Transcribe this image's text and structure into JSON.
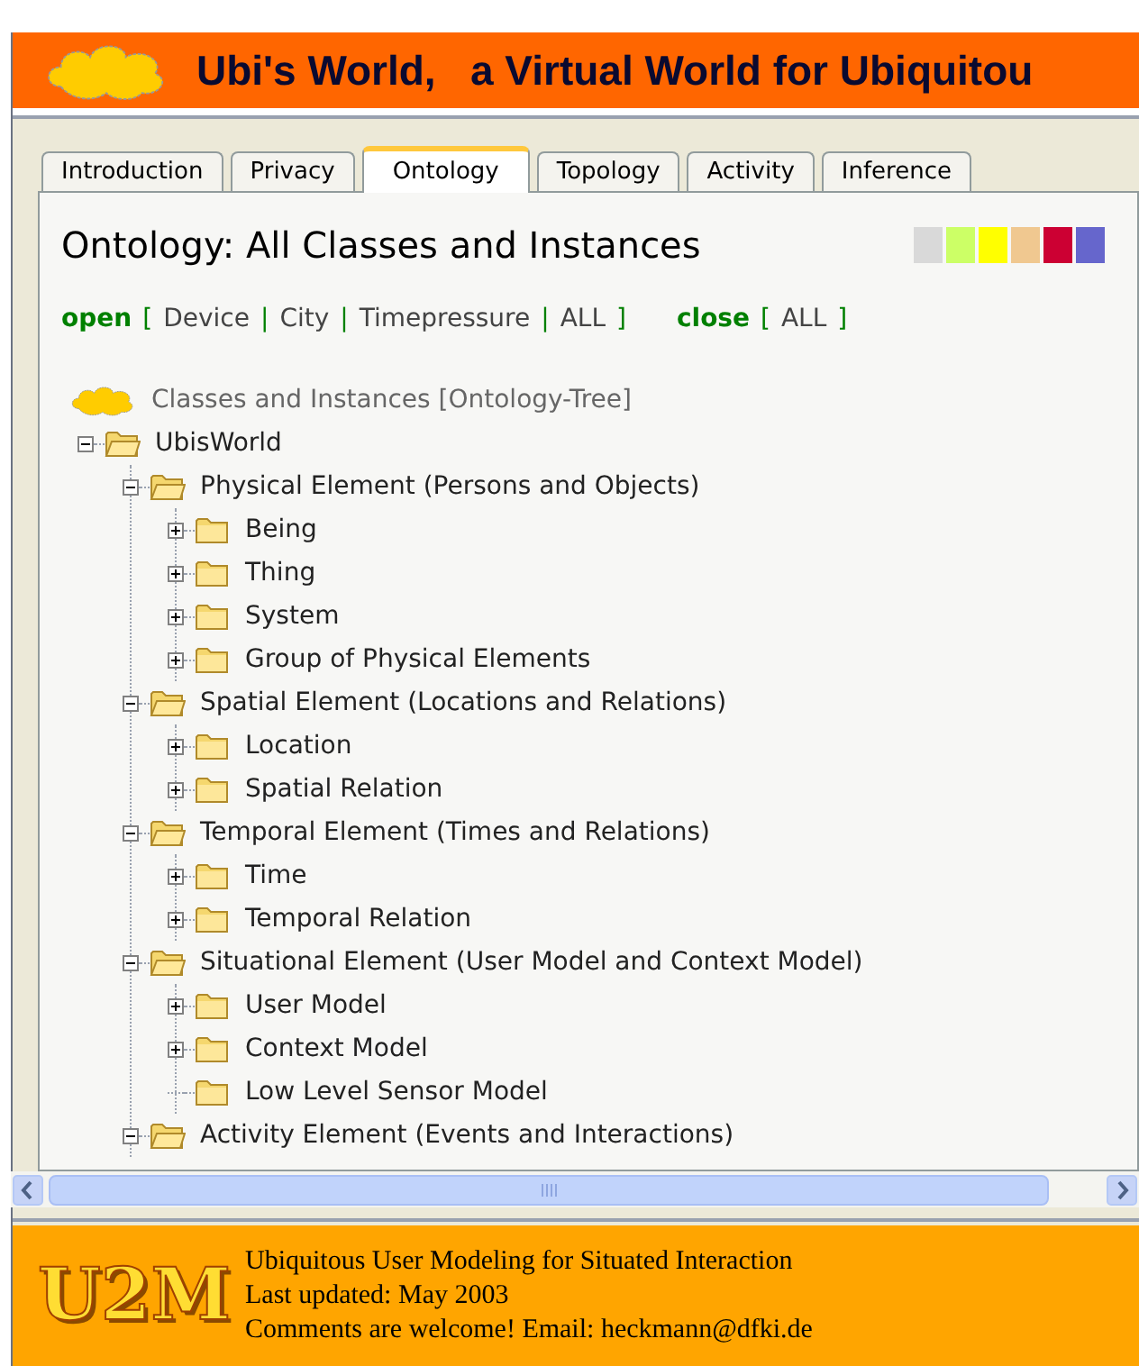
{
  "header": {
    "title": "Ubi's World,   a Virtual World for Ubiquitou"
  },
  "tabs": [
    {
      "label": "Introduction",
      "selected": false
    },
    {
      "label": "Privacy",
      "selected": false
    },
    {
      "label": "Ontology",
      "selected": true
    },
    {
      "label": "Topology",
      "selected": false
    },
    {
      "label": "Activity",
      "selected": false
    },
    {
      "label": "Inference",
      "selected": false
    }
  ],
  "panel": {
    "title": "Ontology: All Classes and Instances",
    "swatches": [
      {
        "color": "#d9d9d9"
      },
      {
        "color": "#ccff66"
      },
      {
        "color": "#ffff00"
      },
      {
        "color": "#f0c890"
      },
      {
        "color": "#cc0033"
      },
      {
        "color": "#6666cc"
      }
    ],
    "actions": [
      {
        "kind": "label",
        "text": "open"
      },
      {
        "kind": "punct",
        "text": "["
      },
      {
        "kind": "link",
        "text": "Device"
      },
      {
        "kind": "punct",
        "text": "|"
      },
      {
        "kind": "link",
        "text": "City"
      },
      {
        "kind": "punct",
        "text": "|"
      },
      {
        "kind": "link",
        "text": "Timepressure"
      },
      {
        "kind": "punct",
        "text": "|"
      },
      {
        "kind": "link",
        "text": "ALL"
      },
      {
        "kind": "punct",
        "text": "]"
      },
      {
        "kind": "gap"
      },
      {
        "kind": "label",
        "text": "close"
      },
      {
        "kind": "punct",
        "text": "["
      },
      {
        "kind": "link",
        "text": "ALL"
      },
      {
        "kind": "punct",
        "text": "]"
      }
    ],
    "tree": {
      "root_label": "Classes and Instances [Ontology-Tree]",
      "nodes": [
        {
          "label": "UbisWorld",
          "kind": "branch",
          "expanded": true,
          "children": [
            {
              "label": "Physical Element (Persons and Objects)",
              "kind": "branch",
              "expanded": true,
              "children": [
                {
                  "label": "Being",
                  "kind": "branch",
                  "expanded": false
                },
                {
                  "label": "Thing",
                  "kind": "branch",
                  "expanded": false
                },
                {
                  "label": "System",
                  "kind": "branch",
                  "expanded": false
                },
                {
                  "label": "Group of Physical Elements",
                  "kind": "branch",
                  "expanded": false
                }
              ]
            },
            {
              "label": "Spatial Element (Locations and Relations)",
              "kind": "branch",
              "expanded": true,
              "children": [
                {
                  "label": "Location",
                  "kind": "branch",
                  "expanded": false
                },
                {
                  "label": "Spatial Relation",
                  "kind": "branch",
                  "expanded": false
                }
              ]
            },
            {
              "label": "Temporal Element (Times and Relations)",
              "kind": "branch",
              "expanded": true,
              "children": [
                {
                  "label": "Time",
                  "kind": "branch",
                  "expanded": false
                },
                {
                  "label": "Temporal Relation",
                  "kind": "branch",
                  "expanded": false
                }
              ]
            },
            {
              "label": "Situational Element (User Model and Context Model)",
              "kind": "branch",
              "expanded": true,
              "children": [
                {
                  "label": "User Model",
                  "kind": "branch",
                  "expanded": false
                },
                {
                  "label": "Context Model",
                  "kind": "branch",
                  "expanded": false
                },
                {
                  "label": "Low Level Sensor Model",
                  "kind": "leaf"
                }
              ]
            },
            {
              "label": "Activity Element (Events and Interactions)",
              "kind": "branch",
              "expanded": true
            }
          ]
        }
      ]
    }
  },
  "footer": {
    "logo": "U2M",
    "lines": [
      "Ubiquitous User Modeling for Situated Interaction",
      "Last updated: May 2003",
      "Comments are welcome! Email: heckmann@dfki.de"
    ]
  }
}
